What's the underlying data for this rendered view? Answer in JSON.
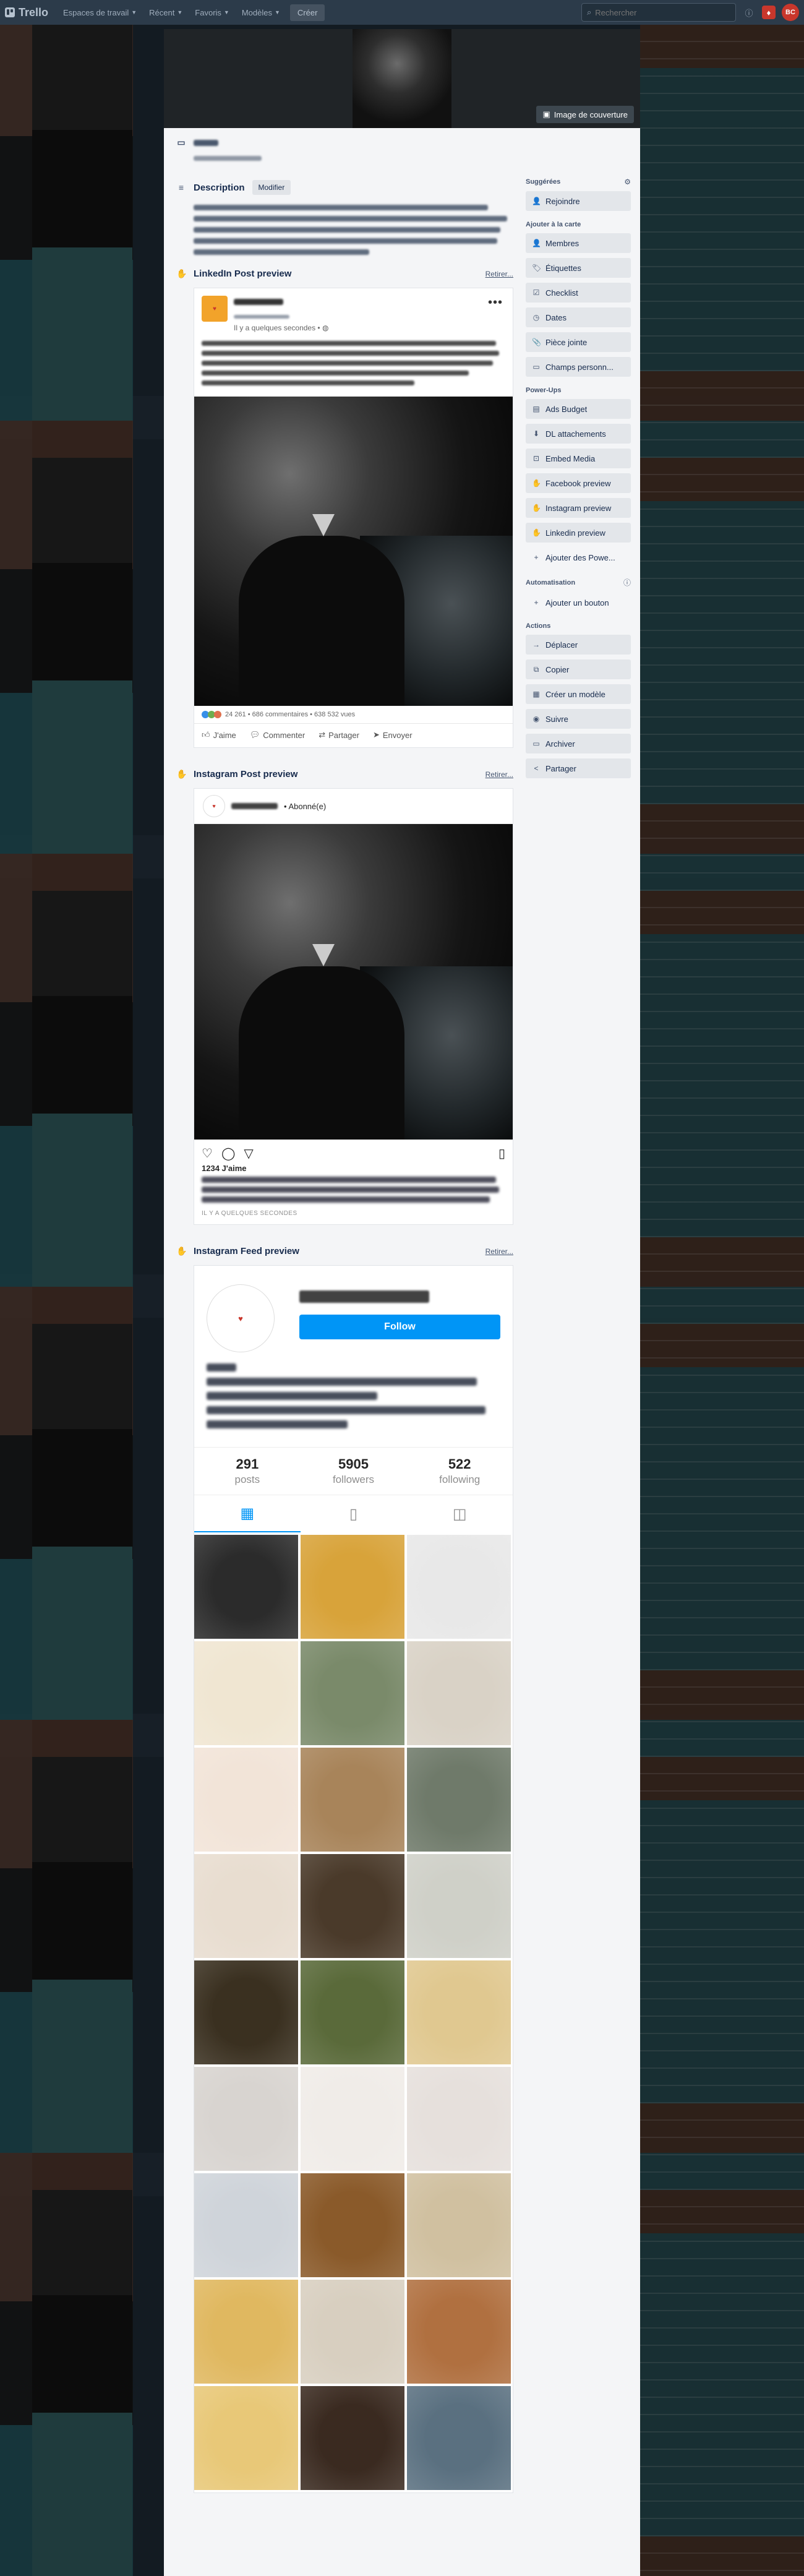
{
  "nav": {
    "logo": "Trello",
    "items": [
      {
        "label": "Espaces de travail"
      },
      {
        "label": "Récent"
      },
      {
        "label": "Favoris"
      },
      {
        "label": "Modèles"
      }
    ],
    "create": "Créer",
    "search_placeholder": "Rechercher"
  },
  "cover": {
    "button": "Image de couverture"
  },
  "description": {
    "title": "Description",
    "modify": "Modifier"
  },
  "linkedin": {
    "title": "LinkedIn Post preview",
    "remove": "Retirer...",
    "time": "Il y a quelques secondes • ",
    "stats": "24 261 • 686 commentaires • 638 532 vues",
    "actions": [
      "J'aime",
      "Commenter",
      "Partager",
      "Envoyer"
    ]
  },
  "instagram_post": {
    "title": "Instagram Post preview",
    "remove": "Retirer...",
    "subscribed": "• Abonné(e)",
    "likes": "1234 J'aime",
    "time": "IL Y A QUELQUES SECONDES"
  },
  "instagram_feed": {
    "title": "Instagram Feed preview",
    "remove": "Retirer...",
    "follow": "Follow",
    "stats": [
      {
        "num": "291",
        "label": "posts"
      },
      {
        "num": "5905",
        "label": "followers"
      },
      {
        "num": "522",
        "label": "following"
      }
    ],
    "grid_colors": [
      "#2b2b2b",
      "#d8a33a",
      "#e8e8e8",
      "#f0e6d2",
      "#7a8a6a",
      "#d9d2c6",
      "#f2e4d8",
      "#a8845a",
      "#6f7a6a",
      "#e8ddd0",
      "#4a3a2a",
      "#cfd0c8",
      "#3a3020",
      "#5a6a3a",
      "#e0c890",
      "#d8d4d0",
      "#f0ece8",
      "#e6e0dc",
      "#cfd4da",
      "#8a5a2a",
      "#d0c0a0",
      "#e0b860",
      "#d8cfc0",
      "#b07040",
      "#e8c878",
      "#3a2a20",
      "#5a7080"
    ]
  },
  "sidebar": {
    "suggested": {
      "title": "Suggérées",
      "items": [
        {
          "icon": "👤",
          "label": "Rejoindre"
        }
      ]
    },
    "add_to_card": {
      "title": "Ajouter à la carte",
      "items": [
        {
          "icon": "👤",
          "label": "Membres"
        },
        {
          "icon": "🏷",
          "label": "Étiquettes"
        },
        {
          "icon": "☑",
          "label": "Checklist"
        },
        {
          "icon": "◷",
          "label": "Dates"
        },
        {
          "icon": "📎",
          "label": "Pièce jointe"
        },
        {
          "icon": "▭",
          "label": "Champs personn..."
        }
      ]
    },
    "powerups": {
      "title": "Power-Ups",
      "items": [
        {
          "icon": "▤",
          "label": "Ads Budget"
        },
        {
          "icon": "⬇",
          "label": "DL attachements"
        },
        {
          "icon": "⊡",
          "label": "Embed Media"
        },
        {
          "icon": "✋",
          "label": "Facebook preview"
        },
        {
          "icon": "✋",
          "label": "Instagram preview"
        },
        {
          "icon": "✋",
          "label": "Linkedin preview"
        },
        {
          "icon": "+",
          "label": "Ajouter des Powe..."
        }
      ]
    },
    "automation": {
      "title": "Automatisation",
      "items": [
        {
          "icon": "+",
          "label": "Ajouter un bouton"
        }
      ]
    },
    "actions": {
      "title": "Actions",
      "items": [
        {
          "icon": "→",
          "label": "Déplacer"
        },
        {
          "icon": "⧉",
          "label": "Copier"
        },
        {
          "icon": "▦",
          "label": "Créer un modèle"
        },
        {
          "icon": "◉",
          "label": "Suivre"
        },
        {
          "icon": "▭",
          "label": "Archiver"
        },
        {
          "icon": "<",
          "label": "Partager"
        }
      ]
    }
  }
}
